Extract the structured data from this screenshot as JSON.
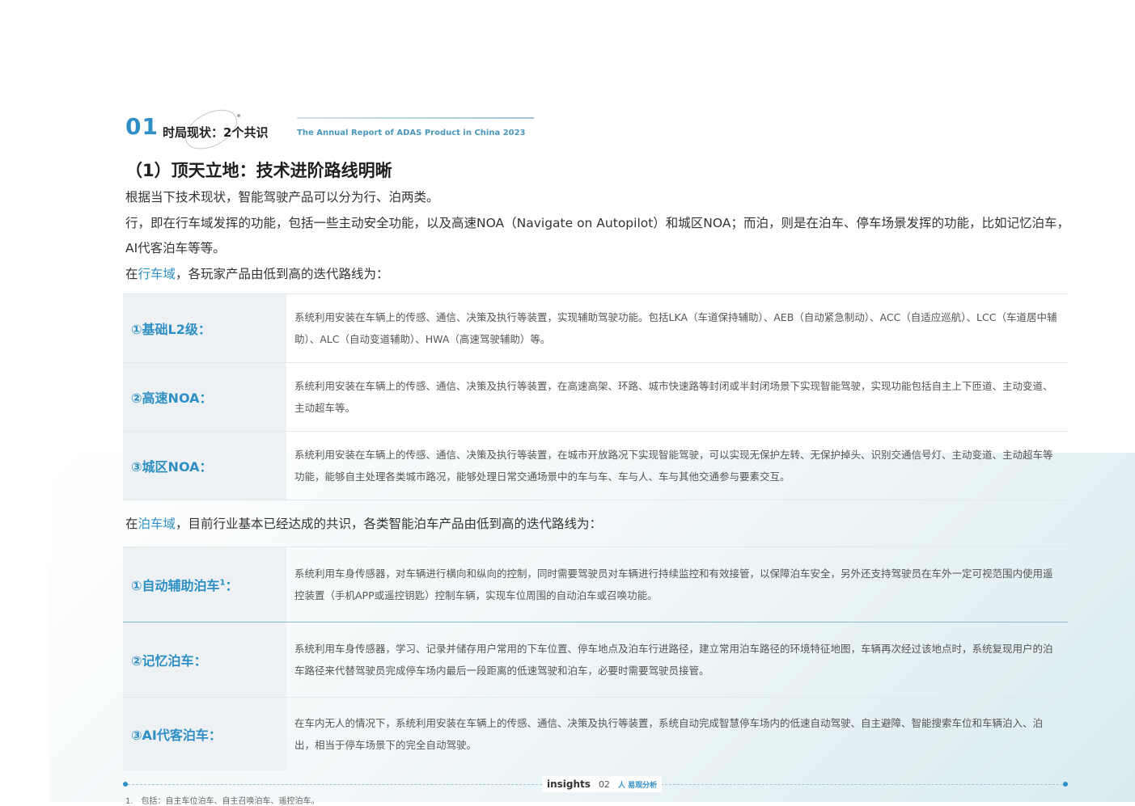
{
  "section": {
    "number": "01",
    "title": "时局现状：2个共识",
    "subtitle": "The Annual Report of ADAS Product in China 2023"
  },
  "subheading": "（1）顶天立地：技术进阶路线明晰",
  "paragraphs": {
    "p1": "根据当下技术现状，智能驾驶产品可以分为行、泊两类。",
    "p2": "行，即在行车域发挥的功能，包括一些主动安全功能，以及高速NOA（Navigate on Autopilot）和城区NOA；而泊，则是在泊车、停车场景发挥的功能，比如记忆泊车，AI代客泊车等等。",
    "p3_pre": "在",
    "p3_accent": "行车域",
    "p3_post": "，各玩家产品由低到高的迭代路线为：",
    "p4_pre": "在",
    "p4_accent": "泊车域",
    "p4_post": "，目前行业基本已经达成的共识，各类智能泊车产品由低到高的迭代路线为："
  },
  "driving_table": [
    {
      "label": "①基础L2级：",
      "desc": "系统利用安装在车辆上的传感、通信、决策及执行等装置，实现辅助驾驶功能。包括LKA（车道保持辅助）、AEB（自动紧急制动）、ACC（自适应巡航）、LCC（车道居中辅助）、ALC（自动变道辅助）、HWA（高速驾驶辅助）等。"
    },
    {
      "label": "②高速NOA：",
      "desc": "系统利用安装在车辆上的传感、通信、决策及执行等装置，在高速高架、环路、城市快速路等封闭或半封闭场景下实现智能驾驶，实现功能包括自主上下匝道、主动变道、主动超车等。"
    },
    {
      "label": "③城区NOA：",
      "desc": "系统利用安装在车辆上的传感、通信、决策及执行等装置，在城市开放路况下实现智能驾驶，可以实现无保护左转、无保护掉头、识别交通信号灯、主动变道、主动超车等功能，能够自主处理各类城市路况，能够处理日常交通场景中的车与车、车与人、车与其他交通参与要素交互。"
    }
  ],
  "parking_table": [
    {
      "label": "①自动辅助泊车",
      "sup": "1",
      "label_tail": "：",
      "desc": "系统利用车身传感器，对车辆进行横向和纵向的控制，同时需要驾驶员对车辆进行持续监控和有效接管，以保障泊车安全，另外还支持驾驶员在车外一定可视范围内使用遥控装置（手机APP或遥控钥匙）控制车辆，实现车位周围的自动泊车或召唤功能。"
    },
    {
      "label": "②记忆泊车",
      "sup": "",
      "label_tail": "：",
      "desc": "系统利用车身传感器，学习、记录并储存用户常用的下车位置、停车地点及泊车行进路径，建立常用泊车路径的环境特征地图，车辆再次经过该地点时，系统复现用户的泊车路径来代替驾驶员完成停车场内最后一段距离的低速驾驶和泊车，必要时需要驾驶员接管。"
    },
    {
      "label": "③AI代客泊车",
      "sup": "",
      "label_tail": "：",
      "desc": "在车内无人的情况下，系统利用安装在车辆上的传感、通信、决策及执行等装置，系统自动完成智慧停车场内的低速自动驾驶、自主避障、智能搜索车位和车辆泊入、泊出，相当于停车场景下的完全自动驾驶。"
    }
  ],
  "footer": {
    "logo": "insights",
    "page": "02",
    "brand": "人 易观分析"
  },
  "footnote": "1.　包括：自主车位泊车、自主召唤泊车、遥控泊车。",
  "colors": {
    "accent": "#2e8fc4",
    "label_bg": "#eef1f3"
  }
}
